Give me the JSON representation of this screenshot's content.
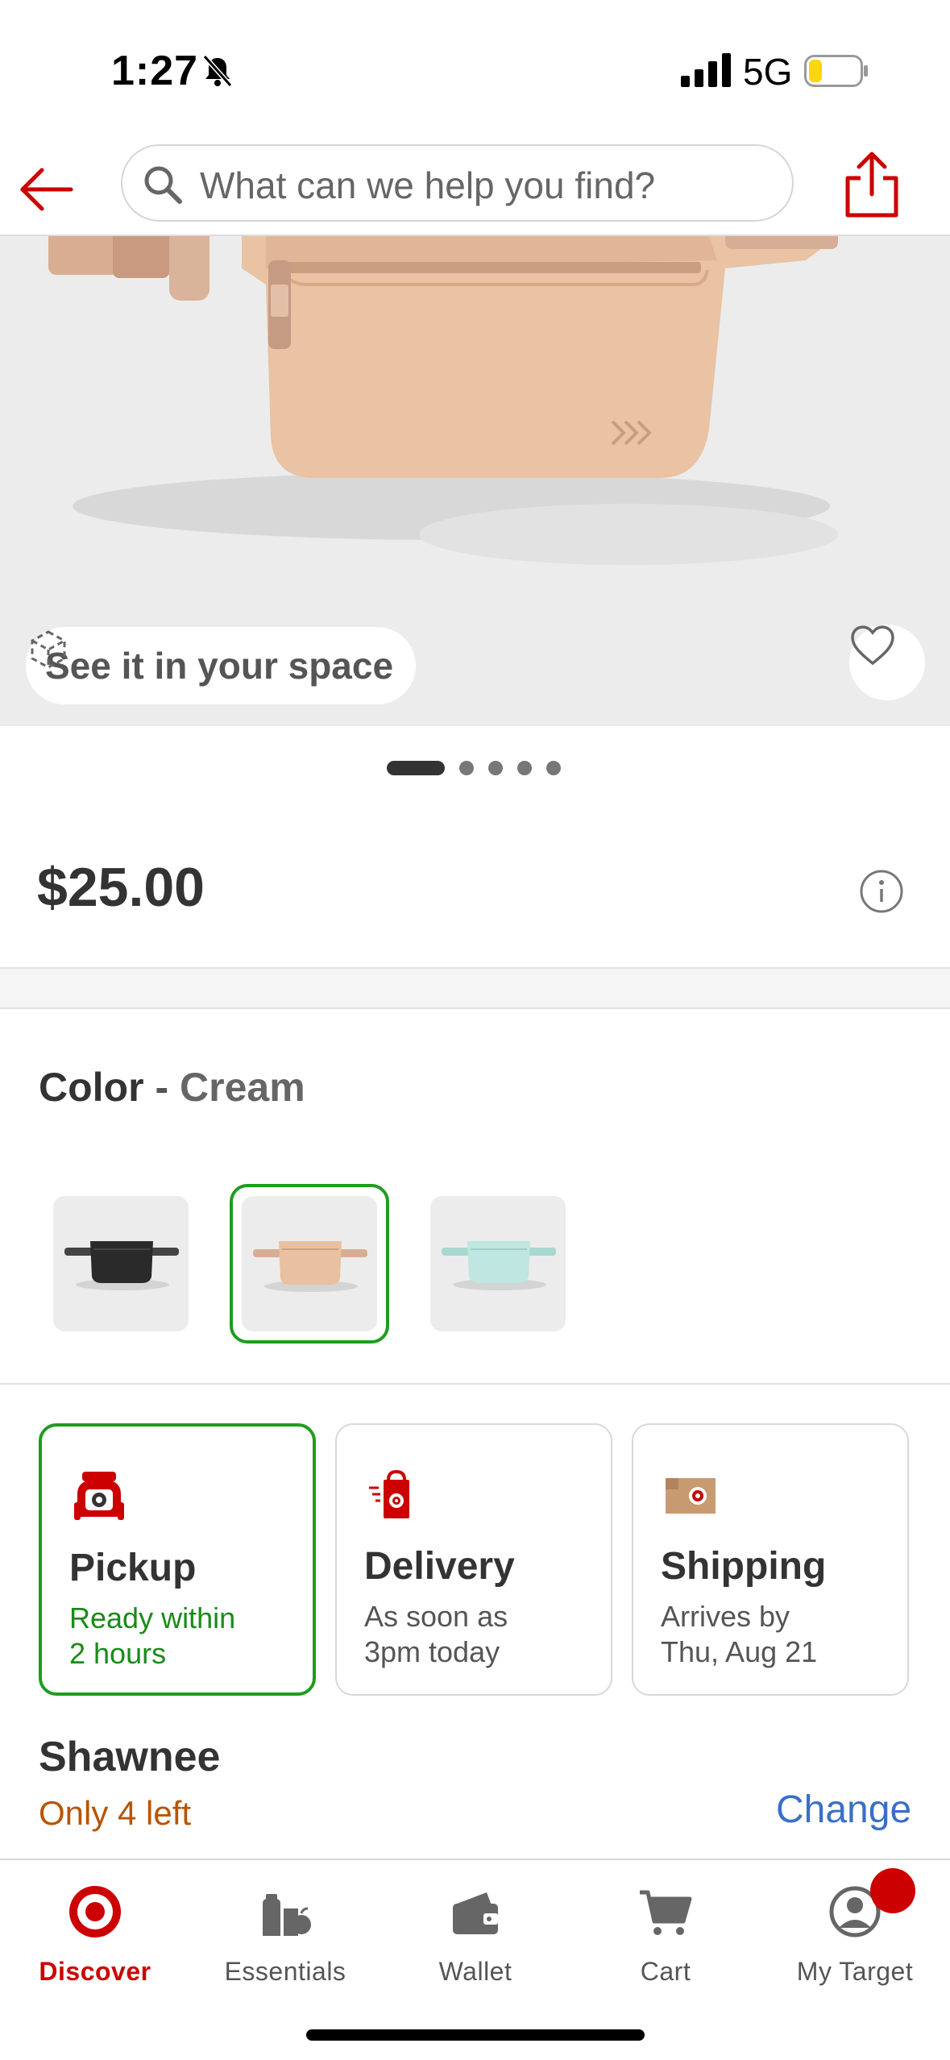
{
  "status_bar": {
    "time": "1:27",
    "network": "5G",
    "battery_color": "#ffd60a"
  },
  "header": {
    "search_placeholder": "What can we help you find?",
    "back_icon": "back-arrow-icon",
    "share_icon": "share-icon"
  },
  "hero": {
    "see_in_space_label": "See it in your space",
    "carousel_total": 5,
    "carousel_active": 1
  },
  "product": {
    "price": "$25.00"
  },
  "color": {
    "label": "Color",
    "separator": "-",
    "selected": "Cream",
    "swatches": [
      {
        "name": "Black",
        "hex": "#2a2a2a",
        "selected": false
      },
      {
        "name": "Cream",
        "hex": "#e8c1a0",
        "selected": true
      },
      {
        "name": "Mint",
        "hex": "#bfe6e0",
        "selected": false
      }
    ]
  },
  "fulfillment": [
    {
      "title": "Pickup",
      "subtitle": "Ready within\n2 hours",
      "selected": true
    },
    {
      "title": "Delivery",
      "subtitle": "As soon as\n3pm today",
      "selected": false
    },
    {
      "title": "Shipping",
      "subtitle": "Arrives by\nThu, Aug 21",
      "selected": false
    }
  ],
  "store": {
    "name": "Shawnee",
    "stock": "Only 4 left",
    "change_label": "Change"
  },
  "bottom_nav": [
    {
      "label": "Discover",
      "icon": "target-logo-icon",
      "active": true
    },
    {
      "label": "Essentials",
      "icon": "essentials-icon",
      "active": false
    },
    {
      "label": "Wallet",
      "icon": "wallet-icon",
      "active": false
    },
    {
      "label": "Cart",
      "icon": "cart-icon",
      "active": false
    },
    {
      "label": "My Target",
      "icon": "account-icon",
      "active": false
    }
  ],
  "colors": {
    "brand_red": "#cc0000",
    "selected_green": "#1d9d1d",
    "link_blue": "#3a6fc8",
    "stock_orange": "#b85400"
  }
}
